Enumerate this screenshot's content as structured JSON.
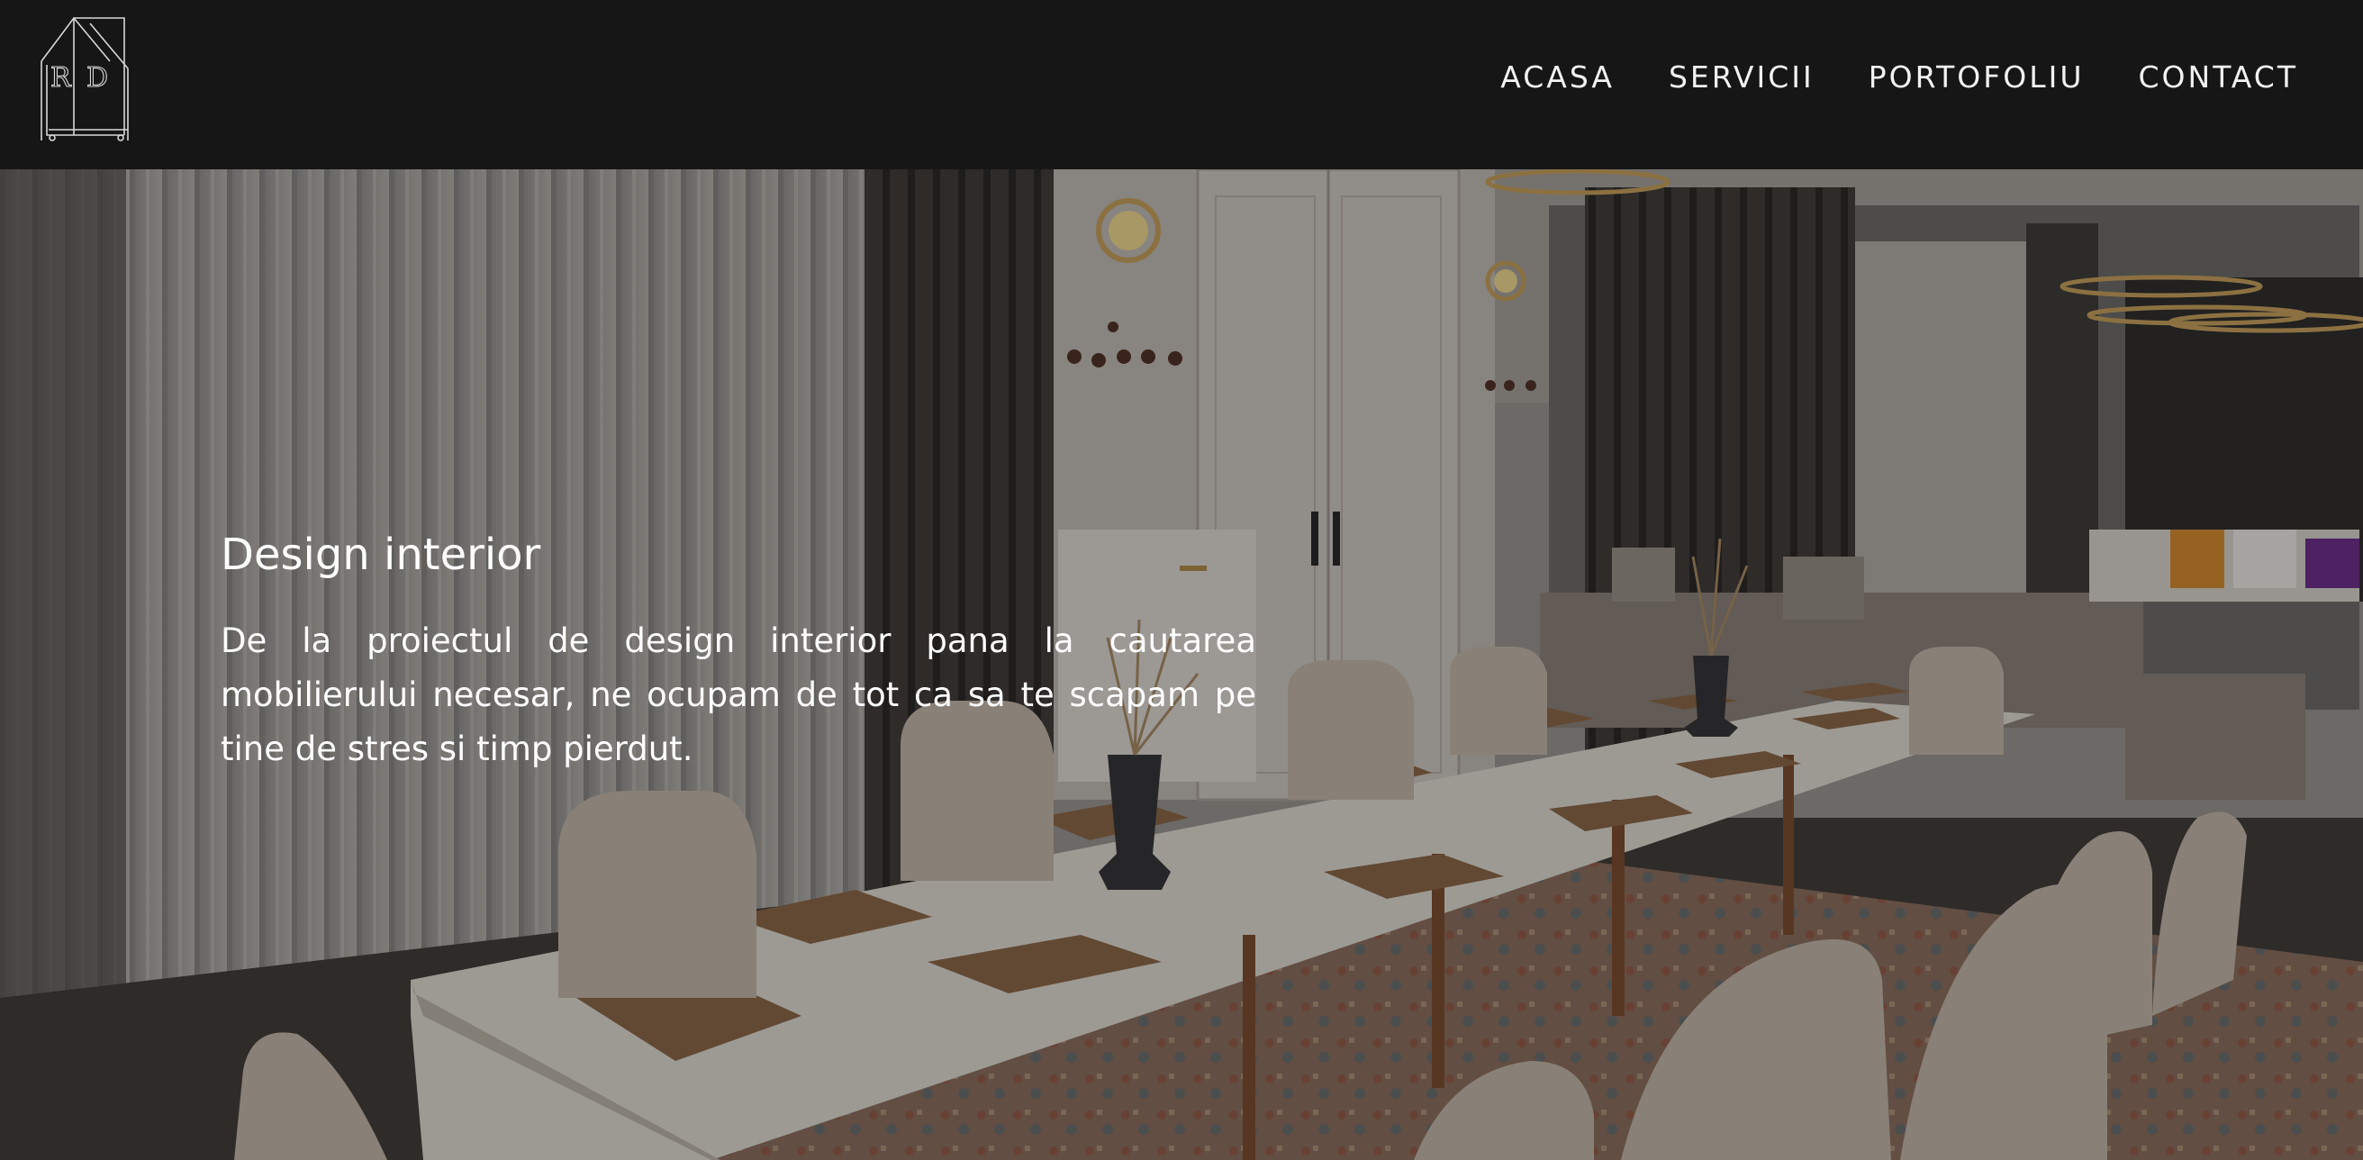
{
  "header": {
    "logo_letters": "RD",
    "nav": [
      "ACASA",
      "SERVICII",
      "PORTOFOLIU",
      "CONTACT"
    ]
  },
  "hero": {
    "title": "Design interior",
    "description": "De la proiectul de design interior pana la cautarea mobilierului necesar, ne ocupam de tot ca sa te scapam pe tine de stres si timp pierdut."
  },
  "colors": {
    "header_bg": "#161616",
    "text": "#ffffff",
    "accent_gold": "#b08a4a"
  }
}
